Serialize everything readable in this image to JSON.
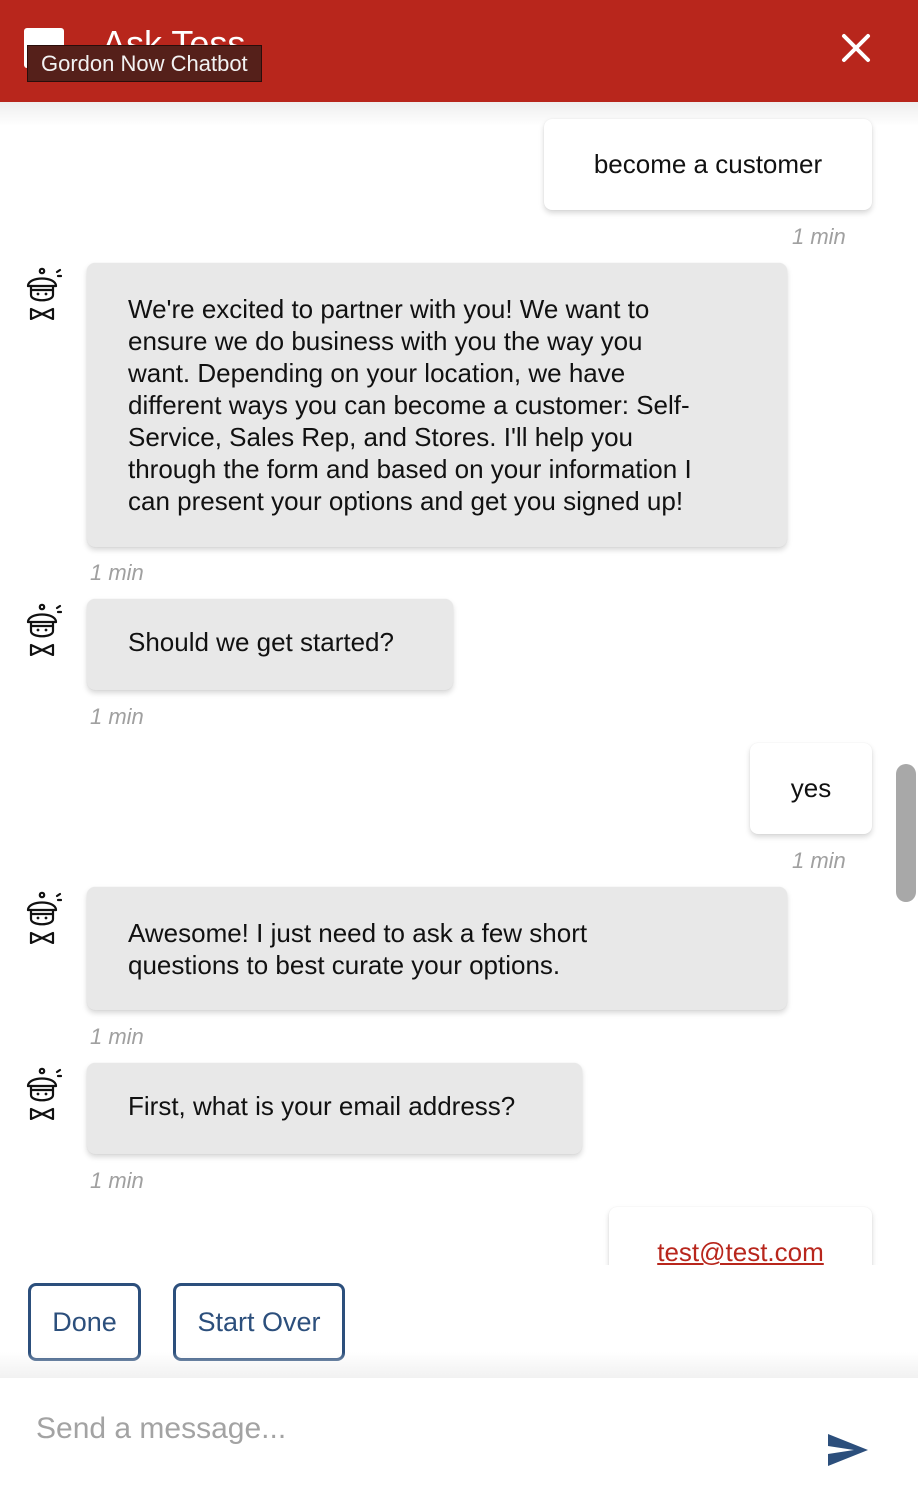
{
  "header": {
    "title": "Ask Tess",
    "tooltip": "Gordon Now Chatbot"
  },
  "messages": [
    {
      "sender": "user",
      "text": "become a customer",
      "time": "1 min"
    },
    {
      "sender": "bot",
      "lines": [
        "We're excited to partner with you! We want to",
        "ensure we do business with you the way you",
        "want. Depending on your location, we have",
        "different ways you can become a customer: Self-",
        "Service, Sales Rep, and Stores. I'll help you",
        "through the form and based on your information I",
        "can present your options and get you signed up!"
      ],
      "time": "1 min"
    },
    {
      "sender": "bot",
      "text": "Should we get started?",
      "time": "1 min"
    },
    {
      "sender": "user",
      "text": "yes",
      "time": "1 min"
    },
    {
      "sender": "bot",
      "lines": [
        "Awesome! I just need to ask a few short",
        "questions to best curate your options."
      ],
      "time": "1 min"
    },
    {
      "sender": "bot",
      "text": "First, what is your email address?",
      "time": "1 min"
    },
    {
      "sender": "user",
      "text": "test@test.com"
    }
  ],
  "quick_replies": [
    "Done",
    "Start Over"
  ],
  "input": {
    "placeholder": "Send a message..."
  },
  "icons": {
    "close": "close-icon",
    "send": "send-icon",
    "bot_avatar": "chef-bot-icon"
  },
  "colors": {
    "brand_red": "#b8261c",
    "accent_blue": "#2c4f7c",
    "bot_bubble": "#e8e8e8",
    "timestamp": "#a0a0a0"
  }
}
